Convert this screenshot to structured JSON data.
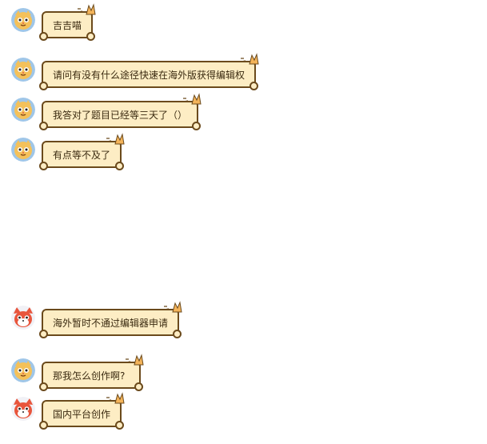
{
  "messages": [
    {
      "sender": "user",
      "text": "吉吉喵"
    },
    {
      "sender": "user",
      "text": "请问有没有什么途径快速在海外版获得编辑权"
    },
    {
      "sender": "user",
      "text": "我答对了题目已经等三天了（）"
    },
    {
      "sender": "user",
      "text": "有点等不及了"
    },
    {
      "sender": "other",
      "text": "海外暂时不通过编辑器申请"
    },
    {
      "sender": "user",
      "text": "那我怎么创作啊?"
    },
    {
      "sender": "other",
      "text": "国内平台创作"
    }
  ],
  "icons": {
    "user_avatar": "cat-face-avatar-icon",
    "other_avatar": "fox-face-avatar-icon",
    "bubble_corner": "cat-ears-decoration-icon"
  },
  "colors": {
    "bubble_fill": "#fdedc4",
    "bubble_border": "#6b4a1c",
    "text": "#3a2a10"
  }
}
